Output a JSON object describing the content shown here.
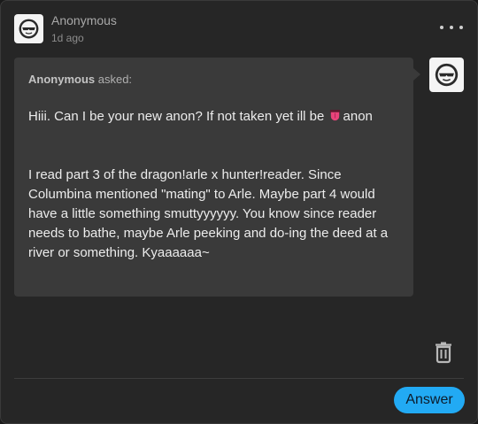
{
  "post": {
    "author": "Anonymous",
    "time_ago": "1d ago"
  },
  "ask": {
    "asker_name": "Anonymous",
    "asker_suffix": " asked:",
    "line1_prefix": "Hiii. Can I be your new anon? If not taken yet ill be ",
    "line1_emoji": "tongue-emoji",
    "line1_suffix": "anon",
    "paragraph2": " I read part 3 of the dragon!arle x hunter!reader. Since Columbina mentioned \"mating\" to Arle. Maybe part 4 would have a little something smuttyyyyyy. You know since reader needs to bathe, maybe Arle peeking and do-ing the deed at a river or something. Kyaaaaaa~"
  },
  "actions": {
    "answer_label": "Answer"
  },
  "colors": {
    "card_bg": "#262626",
    "bubble_bg": "#3a3a3a",
    "answer_button": "#22aaf4",
    "tongue_emoji": "#e8437a"
  },
  "icons": {
    "avatar": "sunglasses-face-icon",
    "more": "more-options-icon",
    "delete": "trash-icon"
  }
}
